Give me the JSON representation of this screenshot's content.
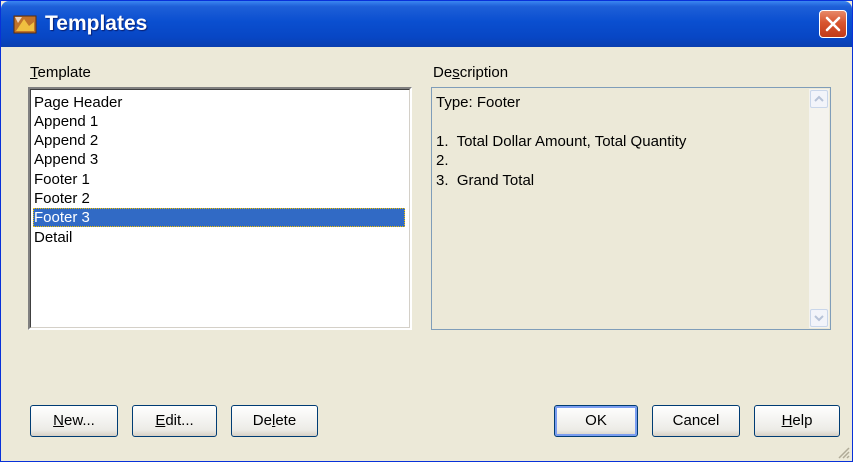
{
  "window": {
    "title": "Templates"
  },
  "template_list": {
    "label_prefix": "",
    "label_mnemonic": "T",
    "label_rest": "emplate",
    "items": [
      "Page Header",
      "Append 1",
      "Append 2",
      "Append 3",
      "Footer 1",
      "Footer 2",
      "Footer 3",
      "Detail"
    ],
    "selected_index": 6
  },
  "description": {
    "label_prefix": "De",
    "label_mnemonic": "s",
    "label_rest": "cription",
    "lines": [
      "Type: Footer",
      "",
      "1.  Total Dollar Amount, Total Quantity",
      "2.",
      "3.  Grand Total"
    ]
  },
  "buttons": {
    "new": {
      "mnemonic": "N",
      "rest": "ew..."
    },
    "edit": {
      "mnemonic": "E",
      "rest": "dit..."
    },
    "delete": {
      "prefix": "De",
      "mnemonic": "l",
      "rest": "ete"
    },
    "ok": {
      "label": "OK"
    },
    "cancel": {
      "label": "Cancel"
    },
    "help": {
      "mnemonic": "H",
      "rest": "elp"
    }
  },
  "colors": {
    "titlebar": "#0a4fd0",
    "selection": "#316ac5",
    "close": "#d8552f"
  }
}
